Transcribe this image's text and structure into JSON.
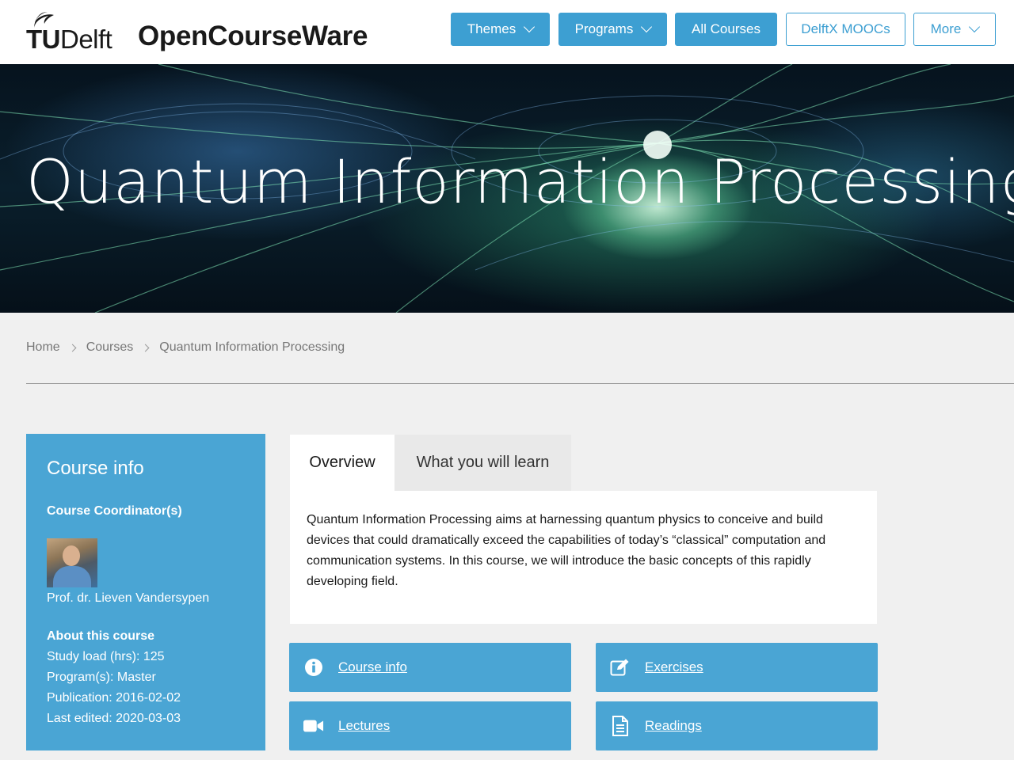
{
  "header": {
    "logo_text_bold": "TU",
    "logo_text_light": "Delft",
    "site_title": "OpenCourseWare",
    "nav": [
      {
        "label": "Themes",
        "style": "solid",
        "dropdown": true
      },
      {
        "label": "Programs",
        "style": "solid",
        "dropdown": true
      },
      {
        "label": "All Courses",
        "style": "solid",
        "dropdown": false
      },
      {
        "label": "DelftX MOOCs",
        "style": "outline",
        "dropdown": false
      },
      {
        "label": "More",
        "style": "outline",
        "dropdown": true
      }
    ]
  },
  "hero": {
    "title": "Quantum Information Processing"
  },
  "breadcrumb": {
    "items": [
      "Home",
      "Courses",
      "Quantum Information Processing"
    ]
  },
  "sidebar": {
    "title": "Course info",
    "coordinator_heading": "Course Coordinator(s)",
    "coordinator_name": "Prof. dr. Lieven Vandersypen",
    "about_heading": "About this course",
    "details": [
      "Study load (hrs): 125",
      "Program(s): Master",
      "Publication: 2016-02-02",
      "Last edited: 2020-03-03"
    ]
  },
  "tabs": {
    "overview": "Overview",
    "learn": "What you will learn"
  },
  "overview_text": "Quantum Information Processing aims at harnessing quantum physics to conceive and build devices that could dramatically exceed the capabilities of today’s “classical” computation and communication systems. In this course, we will introduce the basic concepts of this rapidly developing field.",
  "tiles": [
    {
      "label": "Course info",
      "icon": "info-icon"
    },
    {
      "label": "Exercises",
      "icon": "edit-icon"
    },
    {
      "label": "Lectures",
      "icon": "video-camera-icon"
    },
    {
      "label": "Readings",
      "icon": "document-icon"
    }
  ],
  "colors": {
    "accent": "#3d9fd2",
    "sidebar": "#4aa5d4",
    "background": "#f0f0f0"
  }
}
